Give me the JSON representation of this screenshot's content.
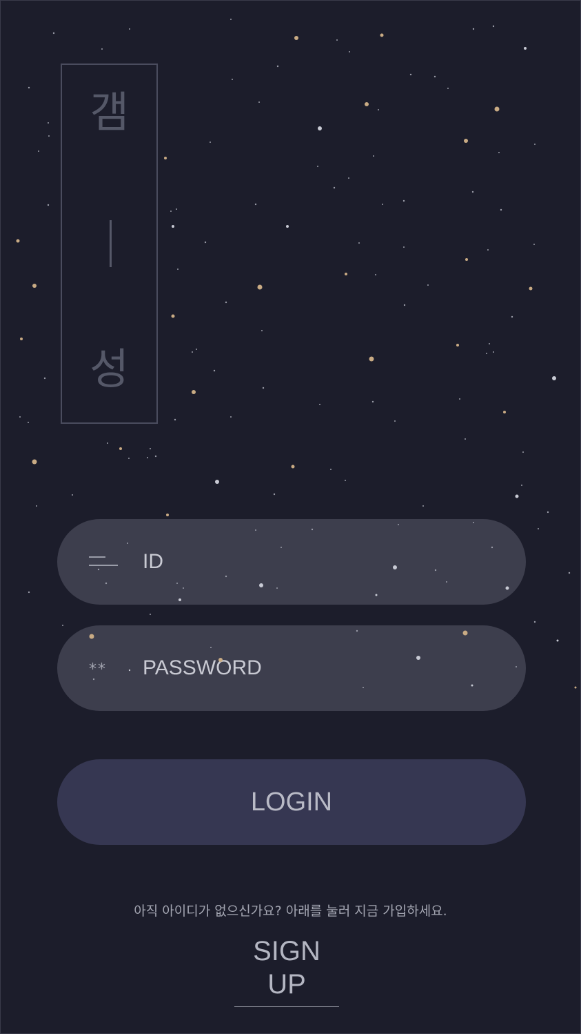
{
  "logo": {
    "top_char": "갬",
    "bottom_char": "성"
  },
  "login_form": {
    "id_field": {
      "placeholder": "ID",
      "value": "",
      "icon": "id-lines-icon"
    },
    "password_field": {
      "placeholder": "PASSWORD",
      "value": "",
      "icon_text": "**",
      "icon": "password-asterisk-icon"
    },
    "login_button_label": "LOGIN"
  },
  "signup": {
    "hint_text": "아직 아이디가 없으신가요? 아래를 눌러 지금 가입하세요.",
    "link_label": "SIGN UP"
  },
  "colors": {
    "background": "#1c1d2b",
    "field_background": "#3d3e4d",
    "login_button": "#363752",
    "star_gold": "#c9ab84",
    "star_white": "#c8cad4"
  }
}
